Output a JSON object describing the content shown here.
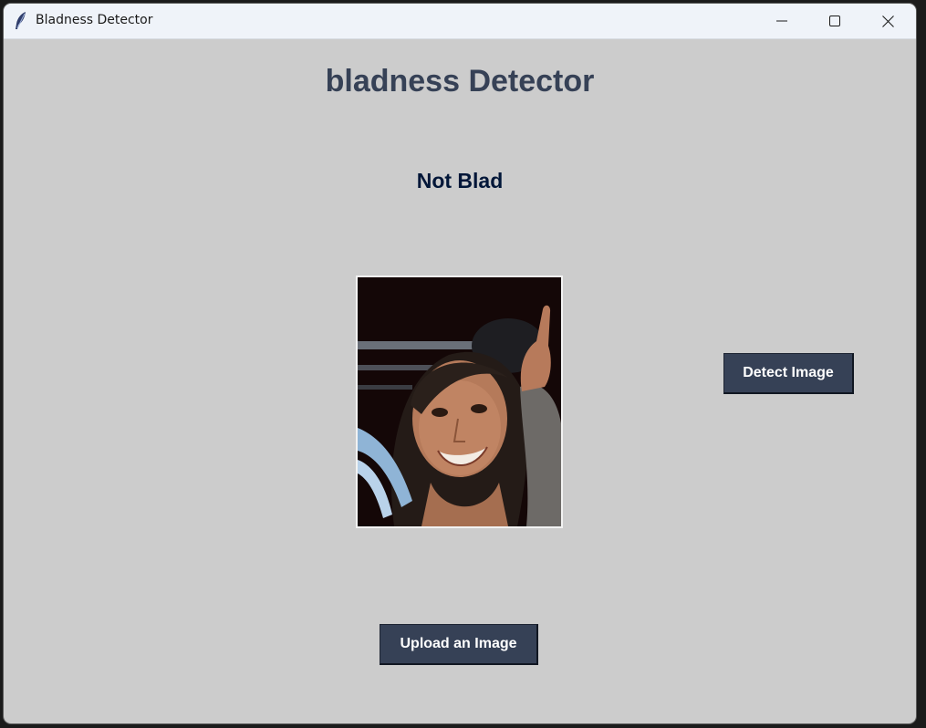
{
  "window": {
    "title": "Bladness Detector",
    "icon": "feather-icon",
    "controls": [
      "minimize-icon",
      "maximize-icon",
      "close-icon"
    ]
  },
  "main": {
    "heading": "bladness Detector",
    "result_label": "Not Blad",
    "image_alt": "uploaded-face-photo",
    "detect_button": "Detect Image",
    "upload_button": "Upload an Image"
  },
  "colors": {
    "background": "#cccccc",
    "heading": "#364156",
    "result": "#011638",
    "button_bg": "#364156",
    "button_fg": "#ffffff",
    "titlebar": "#eff3f9"
  }
}
